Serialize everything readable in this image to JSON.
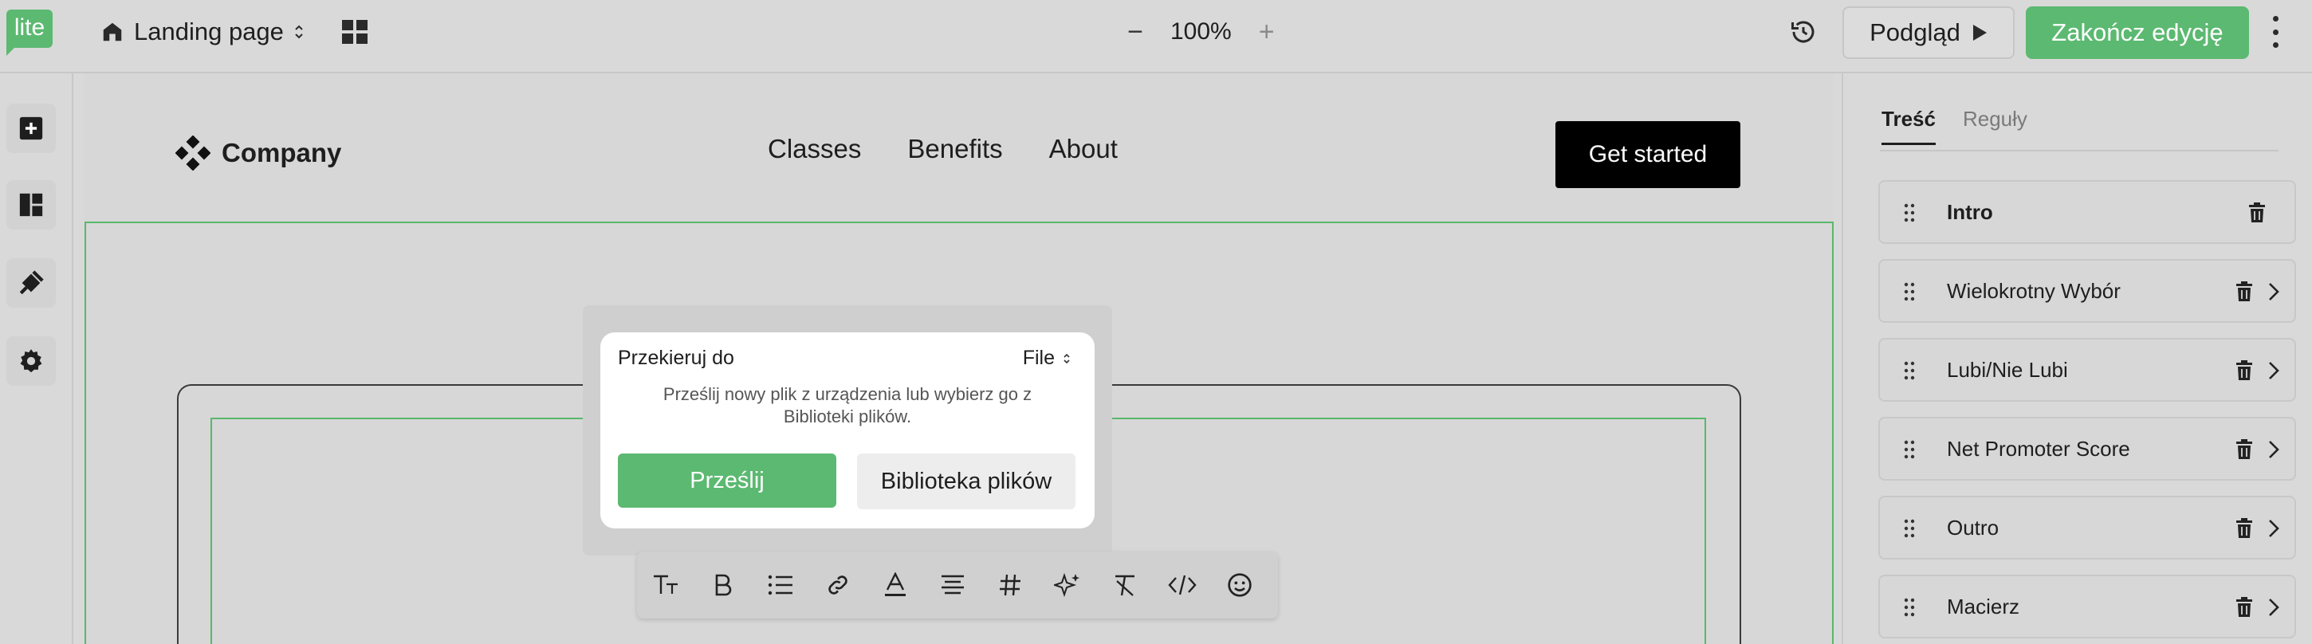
{
  "app": {
    "logo": "lite"
  },
  "toolbar": {
    "page_name": "Landing page",
    "zoom": "100%",
    "zoom_minus": "−",
    "zoom_plus": "+",
    "preview_label": "Podgląd",
    "finish_label": "Zakończ edycję"
  },
  "site": {
    "brand": "Company",
    "nav": [
      "Classes",
      "Benefits",
      "About"
    ],
    "cta": "Get started"
  },
  "popup": {
    "title": "Przekieruj do",
    "type": "File",
    "description": "Prześlij nowy plik z urządzenia lub wybierz go z Biblioteki plików.",
    "upload_label": "Prześlij",
    "library_label": "Biblioteka plików"
  },
  "panel": {
    "tabs": [
      "Treść",
      "Reguły"
    ],
    "items": [
      {
        "label": "Intro"
      },
      {
        "label": "Wielokrotny Wybór"
      },
      {
        "label": "Lubi/Nie Lubi"
      },
      {
        "label": "Net Promoter Score"
      },
      {
        "label": "Outro"
      },
      {
        "label": "Macierz"
      }
    ]
  },
  "colors": {
    "accent": "#5cb971",
    "selection": "#59b86c",
    "cta_bg": "#000000"
  }
}
